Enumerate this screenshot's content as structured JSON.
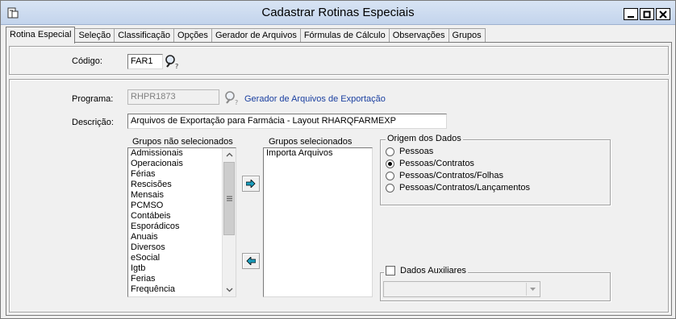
{
  "window": {
    "title": "Cadastrar Rotinas Especiais"
  },
  "tabs": [
    {
      "label": "Rotina Especial"
    },
    {
      "label": "Seleção"
    },
    {
      "label": "Classificação"
    },
    {
      "label": "Opções"
    },
    {
      "label": "Gerador de Arquivos"
    },
    {
      "label": "Fórmulas de Cálculo"
    },
    {
      "label": "Observações"
    },
    {
      "label": "Grupos"
    }
  ],
  "codigo": {
    "label": "Código:",
    "value": "FAR1"
  },
  "programa": {
    "label": "Programa:",
    "value": "RHPR1873",
    "link_text": "Gerador de Arquivos de Exportação"
  },
  "descricao": {
    "label": "Descrição:",
    "value": "Arquivos de Exportação para Farmácia - Layout RHARQFARMEXP"
  },
  "grupos_nao_selecionados": {
    "label": "Grupos não selecionados",
    "items": [
      "Admissionais",
      "Operacionais",
      "Férias",
      "Rescisões",
      "Mensais",
      "PCMSO",
      "Contábeis",
      "Esporádicos",
      "Anuais",
      "Diversos",
      "eSocial",
      "Igtb",
      "Ferias",
      "Frequência"
    ]
  },
  "grupos_selecionados": {
    "label": "Grupos selecionados",
    "items": [
      "Importa Arquivos"
    ]
  },
  "origem_dos_dados": {
    "legend": "Origem dos Dados",
    "options": [
      {
        "label": "Pessoas",
        "selected": false
      },
      {
        "label": "Pessoas/Contratos",
        "selected": true
      },
      {
        "label": "Pessoas/Contratos/Folhas",
        "selected": false
      },
      {
        "label": "Pessoas/Contratos/Lançamentos",
        "selected": false
      }
    ]
  },
  "dados_auxiliares": {
    "label": "Dados Auxiliares",
    "checked": false,
    "value": ""
  },
  "icons": {
    "lookup": "magnifier-icon",
    "move_right": "arrow-right-icon",
    "move_left": "arrow-left-icon"
  },
  "colors": {
    "link": "#1a3fa0",
    "arrow_fill": "#1aa0c0"
  }
}
